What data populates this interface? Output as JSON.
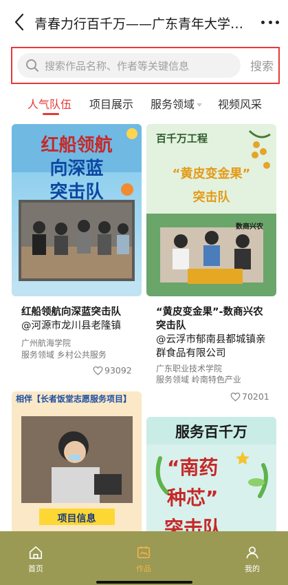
{
  "header": {
    "title": "青春力行百千万——广东青年大学生...",
    "back_icon": "chevron-left-icon",
    "more_icon": "more-dots-icon"
  },
  "search": {
    "placeholder": "搜索作品名称、作者等关键信息",
    "button_label": "搜索"
  },
  "tabs": [
    {
      "label": "人气队伍",
      "active": true
    },
    {
      "label": "项目展示",
      "active": false
    },
    {
      "label": "服务领域",
      "active": false,
      "has_dropdown": true
    },
    {
      "label": "视频风采",
      "active": false
    }
  ],
  "cards": [
    {
      "poster_lines": [
        "红船领航",
        "向深蓝",
        "突击队"
      ],
      "title": "红船领航向深蓝突击队",
      "subtitle": "@河源市龙川县老隆镇",
      "school": "广州航海学院",
      "field": "服务领域 乡村公共服务",
      "likes": "93092"
    },
    {
      "poster_header": "百千万工程",
      "poster_lines": [
        "“黄皮变金果”",
        "突击队"
      ],
      "poster_tag": "数商兴农",
      "title": "“黄皮变金果”-数商兴农突击队",
      "subtitle": "@云浮市郁南县都城镇亲群食品有限公司",
      "school": "广东职业技术学院",
      "field": "服务领域 岭南特色产业",
      "likes": "70201"
    },
    {
      "poster_lines": [
        "相伴【长者饭堂志愿服务项目】",
        "项目信息"
      ]
    },
    {
      "poster_lines": [
        "服务百千万",
        "“南药",
        "种芯”",
        "突击队"
      ]
    }
  ],
  "bottom_nav": [
    {
      "label": "首页",
      "icon": "home-icon",
      "active": false
    },
    {
      "label": "作品",
      "icon": "works-icon",
      "active": true
    },
    {
      "label": "我的",
      "icon": "user-icon",
      "active": false
    }
  ],
  "colors": {
    "accent": "#e53935",
    "nav_bg": "#9a9a54",
    "nav_active": "#f6b34a"
  }
}
